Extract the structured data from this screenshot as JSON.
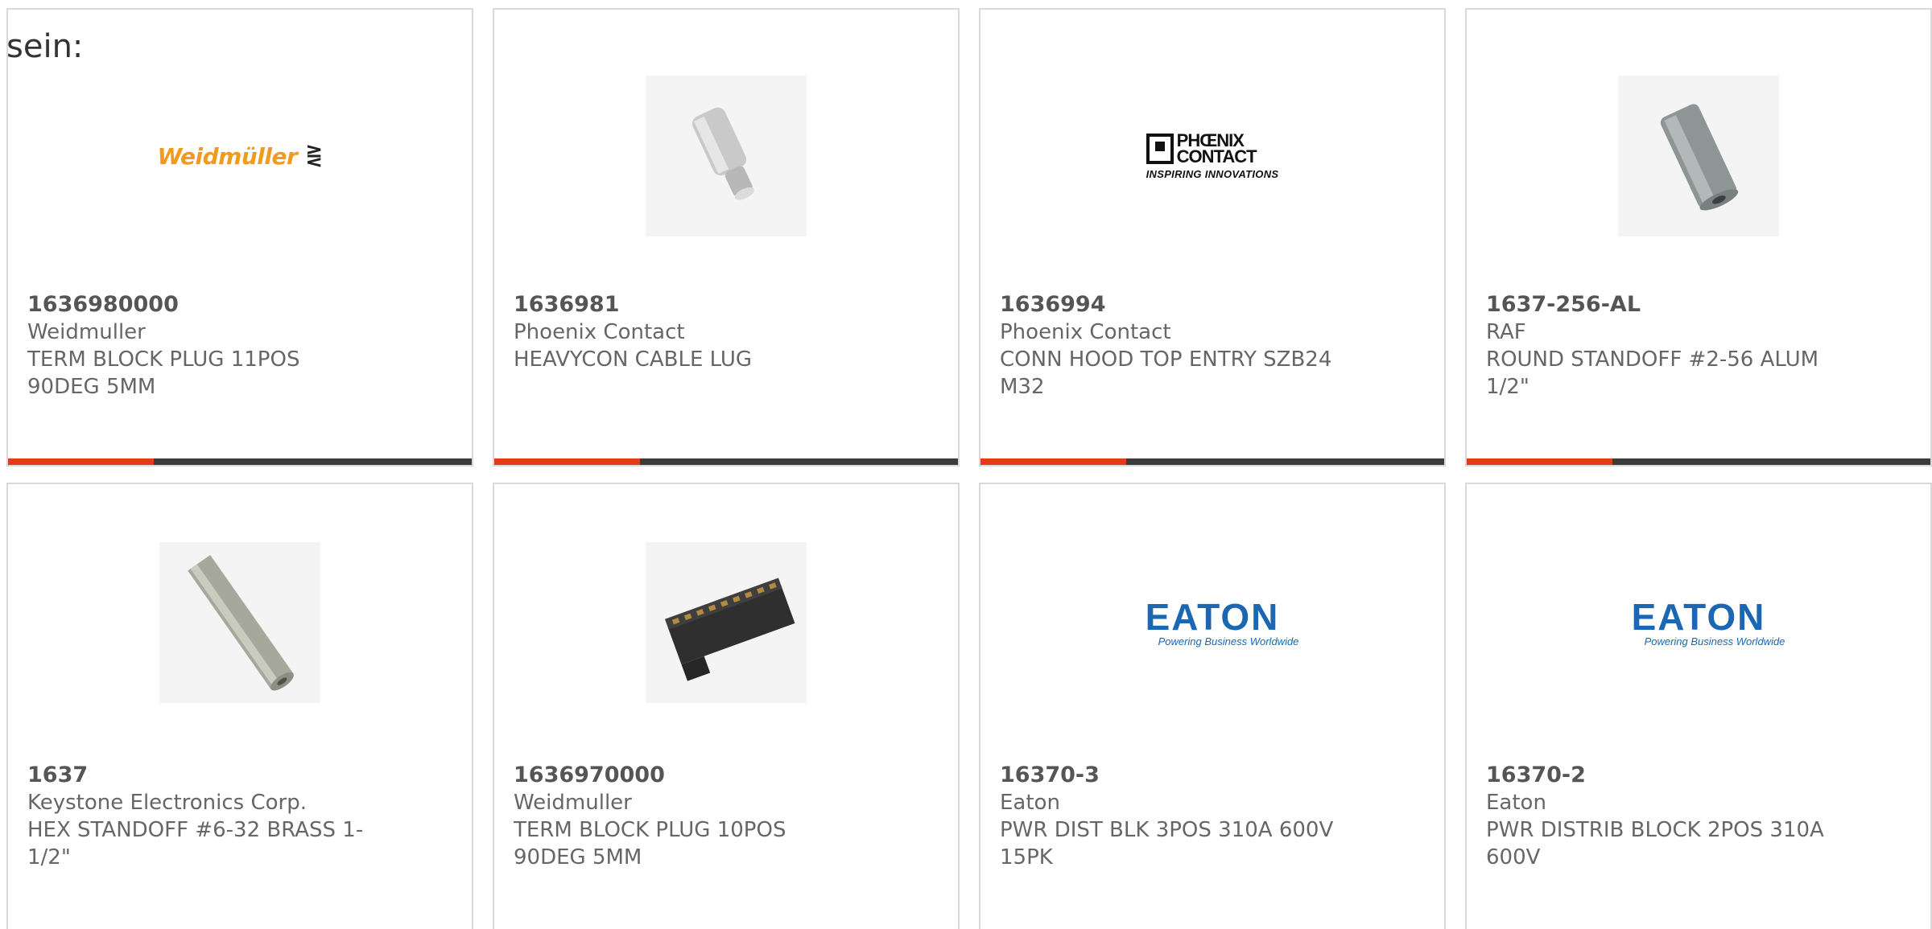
{
  "intro_text": "sein:",
  "accent_color": "#e53b14",
  "bar_color": "#3b3b3b",
  "products": [
    {
      "part_number": "1636980000",
      "manufacturer": "Weidmuller",
      "description": "TERM BLOCK PLUG 11POS 90DEG 5MM",
      "image": "weidmuller-logo",
      "logo_text": "Weidmüller"
    },
    {
      "part_number": "1636981",
      "manufacturer": "Phoenix Contact",
      "description": "HEAVYCON CABLE LUG",
      "image": "cable-lug-photo"
    },
    {
      "part_number": "1636994",
      "manufacturer": "Phoenix Contact",
      "description": "CONN HOOD TOP ENTRY SZB24 M32",
      "image": "phoenix-contact-logo",
      "logo_text": "PHŒNIX CONTACT",
      "logo_line1": "PHŒNIX",
      "logo_line2": "CONTACT",
      "logo_tagline": "INSPIRING INNOVATIONS"
    },
    {
      "part_number": "1637-256-AL",
      "manufacturer": "RAF",
      "description": "ROUND STANDOFF #2-56 ALUM 1/2\"",
      "image": "round-standoff-photo"
    },
    {
      "part_number": "1637",
      "manufacturer": "Keystone Electronics Corp.",
      "description": "HEX STANDOFF #6-32 BRASS 1-1/2\"",
      "image": "hex-standoff-photo"
    },
    {
      "part_number": "1636970000",
      "manufacturer": "Weidmuller",
      "description": "TERM BLOCK PLUG 10POS 90DEG 5MM",
      "image": "terminal-block-photo"
    },
    {
      "part_number": "16370-3",
      "manufacturer": "Eaton",
      "description": "PWR DIST BLK 3POS 310A 600V 15PK",
      "image": "eaton-logo",
      "logo_text": "EATON",
      "logo_tagline": "Powering Business Worldwide"
    },
    {
      "part_number": "16370-2",
      "manufacturer": "Eaton",
      "description": "PWR DISTRIB BLOCK 2POS 310A 600V",
      "image": "eaton-logo",
      "logo_text": "EATON",
      "logo_tagline": "Powering Business Worldwide"
    }
  ]
}
